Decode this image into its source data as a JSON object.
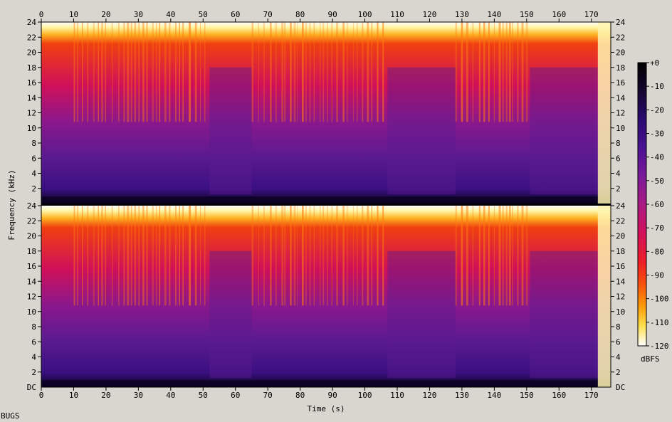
{
  "chart_data": {
    "type": "heatmap",
    "title": "",
    "xlabel": "Time (s)",
    "ylabel": "Frequency (kHz)",
    "x_ticks": [
      "0",
      "10",
      "20",
      "30",
      "40",
      "50",
      "60",
      "70",
      "80",
      "90",
      "100",
      "110",
      "120",
      "130",
      "140",
      "150",
      "160",
      "170"
    ],
    "x_range": [
      0,
      176
    ],
    "y_ticks": [
      "2",
      "4",
      "6",
      "8",
      "10",
      "12",
      "14",
      "16",
      "18",
      "20",
      "22",
      "24"
    ],
    "y_bottom_label": "DC",
    "y_range_khz": [
      0,
      24
    ],
    "channels": 2,
    "colorbar": {
      "label": "dBFS",
      "ticks": [
        "+0",
        "-10",
        "-20",
        "-30",
        "-40",
        "-50",
        "-60",
        "-70",
        "-80",
        "-90",
        "-100",
        "-110",
        "-120"
      ],
      "range": [
        -120,
        0
      ],
      "colors": [
        "#000000",
        "#1a0840",
        "#3a0f80",
        "#6a1a9a",
        "#9a1a8a",
        "#c8106a",
        "#e8142e",
        "#f84010",
        "#fb8a0a",
        "#fdd020",
        "#fff9a8",
        "#ffffff"
      ]
    },
    "series": [
      {
        "levels": [
          0.78,
          0.45,
          0.35,
          0.3,
          0.3,
          0.3,
          0.3,
          0.25,
          0.18,
          0.1,
          0.05,
          0.0
        ]
      }
    ],
    "notes_values": {
      "loud_sections_s": [
        [
          10,
          52
        ],
        [
          65,
          107
        ],
        [
          128,
          150
        ]
      ],
      "quiet_sections_s": [
        [
          52,
          65
        ],
        [
          107,
          128
        ],
        [
          151,
          172
        ]
      ],
      "fade_out_s": 172
    }
  },
  "footer_text": "BUGS"
}
